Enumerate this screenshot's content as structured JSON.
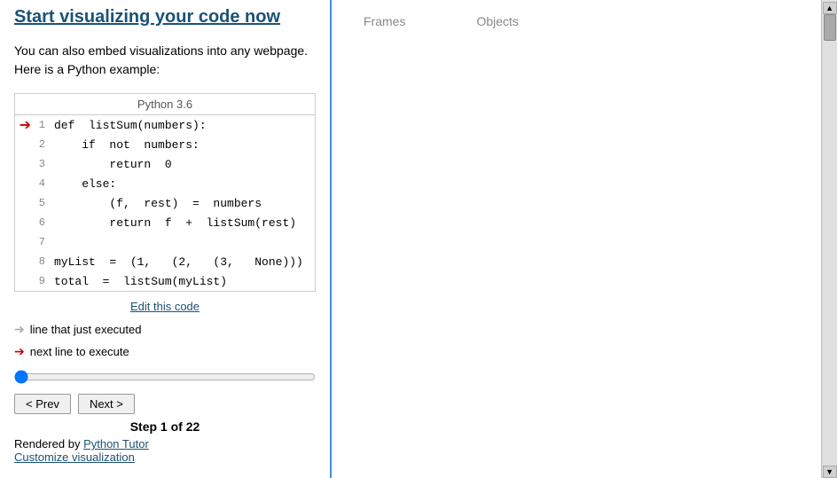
{
  "header": {
    "title": "Start visualizing your code now"
  },
  "intro": {
    "text": "You can also embed visualizations into any webpage. Here is a Python example:"
  },
  "code_block": {
    "language_label": "Python 3.6",
    "lines": [
      {
        "num": 1,
        "code": "def  listSum(numbers):",
        "arrow": "red"
      },
      {
        "num": 2,
        "code": "    if  not  numbers:",
        "arrow": "none"
      },
      {
        "num": 3,
        "code": "        return  0",
        "arrow": "none"
      },
      {
        "num": 4,
        "code": "    else:",
        "arrow": "none"
      },
      {
        "num": 5,
        "code": "        (f,  rest)  =  numbers",
        "arrow": "none"
      },
      {
        "num": 6,
        "code": "        return  f  +  listSum(rest)",
        "arrow": "none"
      },
      {
        "num": 7,
        "code": "",
        "arrow": "none"
      },
      {
        "num": 8,
        "code": "myList  =  (1,   (2,   (3,   None)))",
        "arrow": "none"
      },
      {
        "num": 9,
        "code": "total  =  listSum(myList)",
        "arrow": "none"
      }
    ]
  },
  "edit_link": {
    "label": "Edit this code"
  },
  "legend": {
    "gray_arrow_label": "line that just executed",
    "red_arrow_label": "next line to execute"
  },
  "controls": {
    "prev_label": "< Prev",
    "next_label": "Next >",
    "step_label": "Step 1 of 22"
  },
  "footer": {
    "rendered_by_text": "Rendered by ",
    "rendered_by_link": "Python Tutor",
    "customize_link": "Customize visualization"
  },
  "right_panel": {
    "frames_label": "Frames",
    "objects_label": "Objects"
  }
}
